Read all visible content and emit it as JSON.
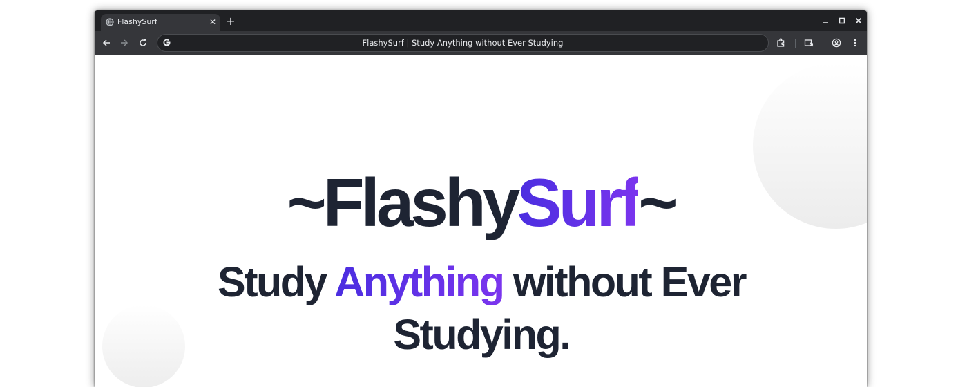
{
  "browser": {
    "tab": {
      "title": "FlashySurf",
      "close_glyph": "✕"
    },
    "new_tab_glyph": "+",
    "omnibox": {
      "text": "FlashySurf | Study Anything without Ever Studying"
    },
    "icons": {
      "tab_favicon": "globe-icon",
      "back": "back-arrow-icon",
      "forward": "forward-arrow-icon",
      "reload": "reload-icon",
      "omnibox_logo": "google-g-icon",
      "extensions": "puzzle-icon",
      "media": "media-cast-icon",
      "profile": "profile-icon",
      "menu": "kebab-menu-icon",
      "minimize": "minimize-icon",
      "maximize": "maximize-icon",
      "close": "close-window-icon"
    },
    "colors": {
      "frame": "#202124",
      "toolbar": "#35363a",
      "text": "#e8eaed"
    }
  },
  "page": {
    "brand": {
      "prefix": "~Flashy",
      "accent": "Surf",
      "suffix": "~"
    },
    "headline": {
      "part1": "Study ",
      "accent": "Anything",
      "part2": " without Ever Studying."
    },
    "colors": {
      "text": "#1e2433",
      "accent_start": "#4a2ee0",
      "accent_end": "#7b35ee"
    }
  }
}
